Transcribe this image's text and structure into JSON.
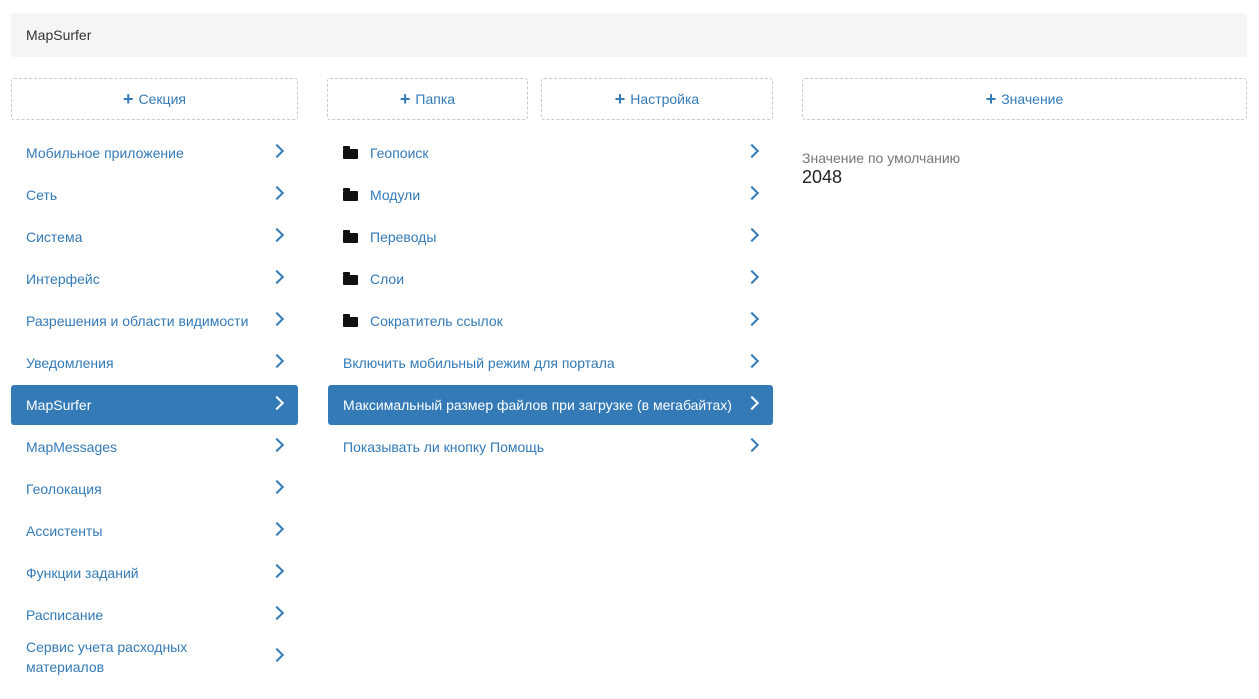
{
  "breadcrumb": {
    "title": "MapSurfer"
  },
  "buttons": {
    "add_section": "Секция",
    "add_folder": "Папка",
    "add_setting": "Настройка",
    "add_value": "Значение"
  },
  "sections": [
    {
      "label": "Мобильное приложение"
    },
    {
      "label": "Сеть"
    },
    {
      "label": "Система"
    },
    {
      "label": "Интерфейс"
    },
    {
      "label": "Разрешения и области видимости"
    },
    {
      "label": "Уведомления"
    },
    {
      "label": "MapSurfer",
      "active": true
    },
    {
      "label": "MapMessages"
    },
    {
      "label": "Геолокация"
    },
    {
      "label": "Ассистенты"
    },
    {
      "label": "Функции заданий"
    },
    {
      "label": "Расписание"
    },
    {
      "label": "Сервис учета расходных материалов"
    }
  ],
  "settings": [
    {
      "label": "Геопоиск",
      "icon": "folder-icon"
    },
    {
      "label": "Модули",
      "icon": "folder-icon"
    },
    {
      "label": "Переводы",
      "icon": "folder-icon"
    },
    {
      "label": "Слои",
      "icon": "folder-icon"
    },
    {
      "label": "Сократитель ссылок",
      "icon": "folder-icon"
    },
    {
      "label": "Включить мобильный режим для портала"
    },
    {
      "label": "Максимальный размер файлов при загрузке (в мегабайтах)",
      "active": true
    },
    {
      "label": "Показывать ли кнопку Помощь"
    }
  ],
  "value_panel": {
    "default_label": "Значение по умолчанию",
    "default_value": "2048"
  },
  "colors": {
    "accent": "#337ab7",
    "breadcrumb_bg": "#f5f5f5"
  }
}
